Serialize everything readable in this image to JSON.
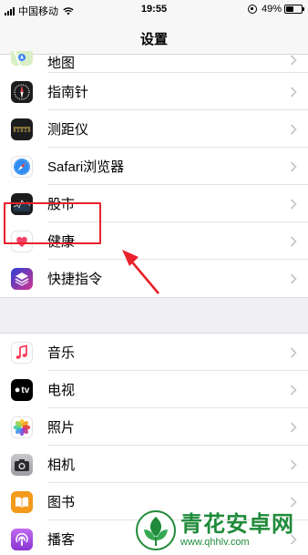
{
  "status_bar": {
    "carrier": "中国移动",
    "time": "19:55",
    "battery": "49%",
    "battery_level": 0.49
  },
  "nav": {
    "title": "设置"
  },
  "group1": [
    {
      "label": "地图",
      "icon": "maps-icon"
    },
    {
      "label": "指南针",
      "icon": "compass-icon"
    },
    {
      "label": "测距仪",
      "icon": "measure-icon"
    },
    {
      "label": "Safari浏览器",
      "icon": "safari-icon"
    },
    {
      "label": "股市",
      "icon": "stocks-icon"
    },
    {
      "label": "健康",
      "icon": "health-icon"
    },
    {
      "label": "快捷指令",
      "icon": "shortcuts-icon"
    }
  ],
  "group2": [
    {
      "label": "音乐",
      "icon": "music-icon"
    },
    {
      "label": "电视",
      "icon": "tv-icon",
      "icon_text": "tv"
    },
    {
      "label": "照片",
      "icon": "photos-icon"
    },
    {
      "label": "相机",
      "icon": "camera-icon"
    },
    {
      "label": "图书",
      "icon": "books-icon"
    },
    {
      "label": "播客",
      "icon": "podcasts-icon"
    }
  ],
  "watermark": {
    "name": "青花安卓网",
    "url": "www.qhhlv.com"
  },
  "colors": {
    "highlight": "#e8212a",
    "watermark": "#1f8b3a",
    "separator": "#efeff4"
  }
}
